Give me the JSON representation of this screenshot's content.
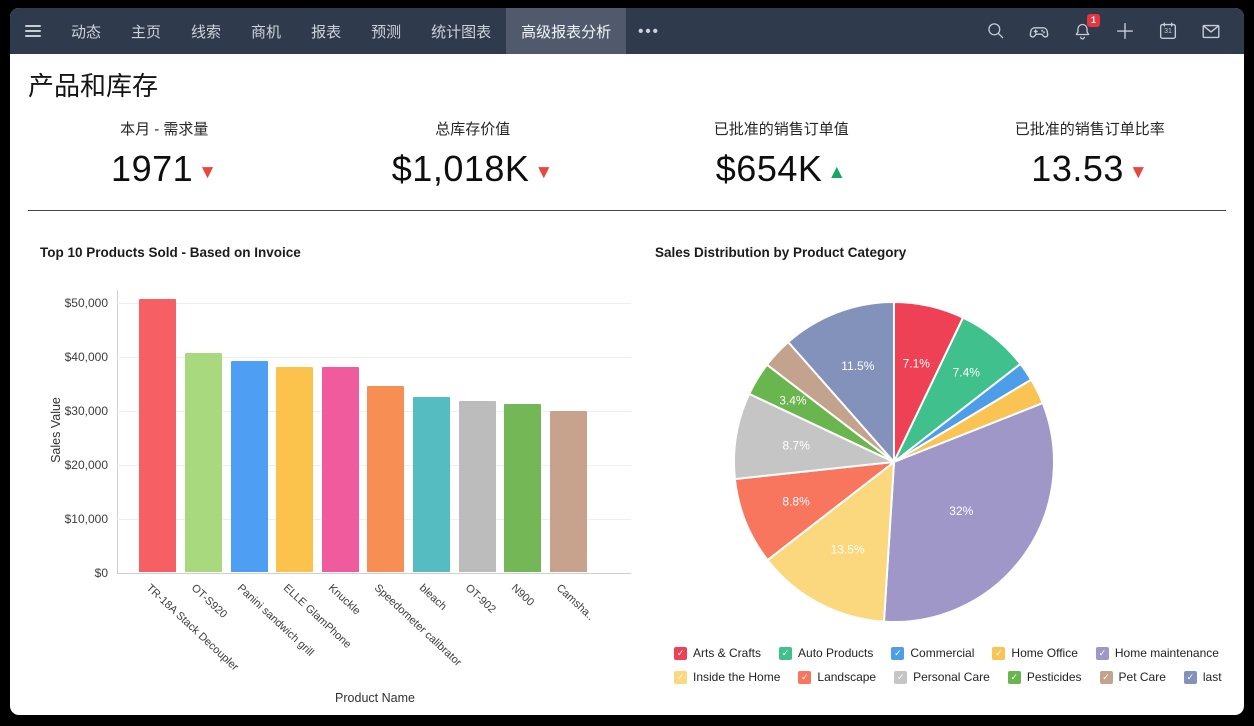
{
  "nav": {
    "items": [
      {
        "label": "动态"
      },
      {
        "label": "主页"
      },
      {
        "label": "线索"
      },
      {
        "label": "商机"
      },
      {
        "label": "报表"
      },
      {
        "label": "预测"
      },
      {
        "label": "统计图表"
      },
      {
        "label": "高级报表分析"
      }
    ],
    "active_tab": "高级报表分析",
    "more_label": "•••",
    "icons": [
      "search-icon",
      "gamepad-icon",
      "bell-icon",
      "plus-icon",
      "calendar-icon",
      "mail-icon"
    ],
    "bell_badge": "1",
    "calendar_glyph": "31"
  },
  "page": {
    "title": "产品和库存"
  },
  "kpis": [
    {
      "label": "本月 - 需求量",
      "value": "1971",
      "trend": "down"
    },
    {
      "label": "总库存价值",
      "value": "$1,018K",
      "trend": "down"
    },
    {
      "label": "已批准的销售订单值",
      "value": "$654K",
      "trend": "up"
    },
    {
      "label": "已批准的销售订单比率",
      "value": "13.53",
      "trend": "down"
    }
  ],
  "icons": {
    "trend_up": "▲",
    "trend_down": "▼",
    "check": "✓"
  },
  "colors": {
    "nav_bg": "#2f3a4c",
    "nav_active": "#505a6c",
    "nav_text": "#cdd3dc",
    "badge": "#e5353f",
    "trend_up": "#16a765",
    "trend_down": "#e8473f",
    "divider": "#454545",
    "grid": "#efefef"
  },
  "chart_data": [
    {
      "type": "bar",
      "title": "Top 10 Products Sold - Based on Invoice",
      "xlabel": "Product Name",
      "ylabel": "Sales Value",
      "ylim": [
        0,
        52400
      ],
      "yticks": [
        0,
        10000,
        20000,
        30000,
        40000,
        50000
      ],
      "grid": true,
      "categories": [
        "TR-18A Stack Decoupler",
        "OT-S920",
        "Panini sandwich grill",
        "ELLE GlamPhone",
        "Knuckle",
        "Speedometer calibrator",
        "bleach",
        "OT-902",
        "N900",
        "Camsha.."
      ],
      "values": [
        50500,
        40600,
        39000,
        38000,
        37900,
        34500,
        32400,
        31600,
        31200,
        29800
      ],
      "bar_colors": [
        "#f65f63",
        "#a9d97f",
        "#4e9ef3",
        "#fbc34c",
        "#ef5b9c",
        "#f78e54",
        "#55bdc2",
        "#bcbcbc",
        "#74b757",
        "#c7a28c"
      ]
    },
    {
      "type": "pie",
      "title": "Sales Distribution by Product Category",
      "legend_position": "bottom",
      "slices": [
        {
          "label": "Arts & Crafts",
          "value": 7.1,
          "display": "7.1%",
          "color": "#ef4156",
          "label_r": 0.63
        },
        {
          "label": "Auto Products",
          "value": 7.4,
          "display": "7.4%",
          "color": "#3fc08c",
          "label_r": 0.72
        },
        {
          "label": "Commercial",
          "value": 1.9,
          "display": null,
          "color": "#4d9de9"
        },
        {
          "label": "Home Office",
          "value": 2.6,
          "display": null,
          "color": "#f9c454"
        },
        {
          "label": "Home maintenance",
          "value": 32,
          "display": "32%",
          "color": "#9f97c7",
          "label_r": 0.52
        },
        {
          "label": "Inside the Home",
          "value": 13.5,
          "display": "13.5%",
          "color": "#fbd77d",
          "label_r": 0.62
        },
        {
          "label": "Landscape",
          "value": 8.8,
          "display": "8.8%",
          "color": "#f7765d",
          "label_r": 0.66
        },
        {
          "label": "Personal Care",
          "value": 8.7,
          "display": "8.7%",
          "color": "#c5c5c5",
          "label_r": 0.62
        },
        {
          "label": "Pesticides",
          "value": 3.4,
          "display": "3.4%",
          "color": "#69b54e",
          "label_r": 0.74
        },
        {
          "label": "Pet Care",
          "value": 3.1,
          "display": null,
          "color": "#c3a38d"
        },
        {
          "label": "last",
          "value": 11.5,
          "display": "11.5%",
          "color": "#8292ba",
          "label_r": 0.64
        }
      ]
    }
  ]
}
